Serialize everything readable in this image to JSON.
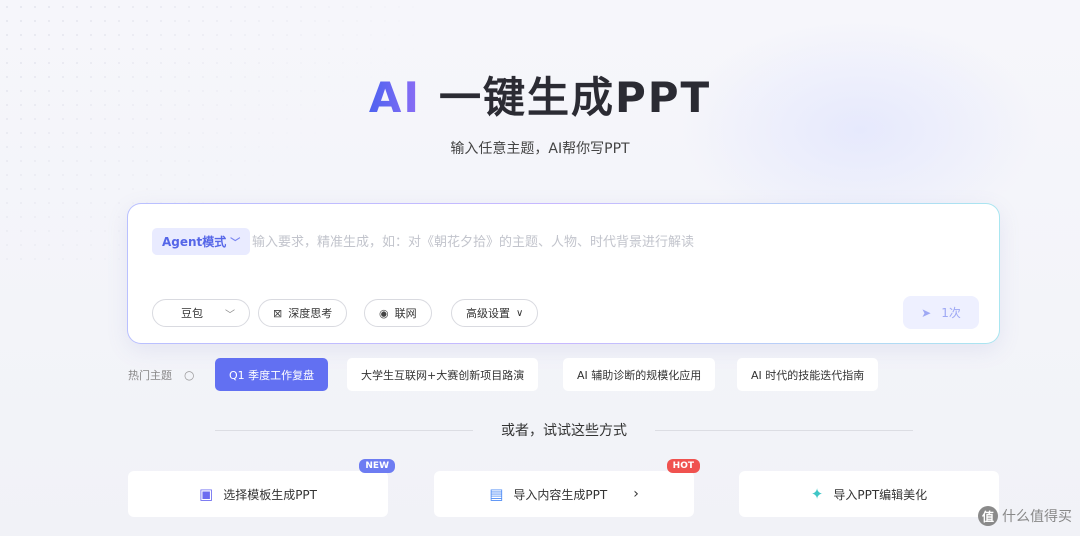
{
  "hero": {
    "title_ai": "AI",
    "title_rest": "一键生成PPT",
    "subtitle": "输入任意主题，AI帮你写PPT"
  },
  "input": {
    "mode_label": "Agent模式",
    "placeholder": "输入要求，精准生成，如：对《朝花夕拾》的主题、人物、时代背景进行解读",
    "value": "",
    "model_label": "豆包",
    "deep_think_label": "深度思考",
    "web_label": "联网",
    "advanced_label": "高级设置",
    "send_count": "1次"
  },
  "hot_topics": {
    "label": "热门主题",
    "items": [
      {
        "label": "Q1 季度工作复盘",
        "active": true
      },
      {
        "label": "大学生互联网+大赛创新项目路演",
        "active": false
      },
      {
        "label": "AI 辅助诊断的规模化应用",
        "active": false
      },
      {
        "label": "AI 时代的技能迭代指南",
        "active": false
      }
    ]
  },
  "or_text": "或者，试试这些方式",
  "options": [
    {
      "label": "选择模板生成PPT",
      "tag": "NEW",
      "icon": "template-icon"
    },
    {
      "label": "导入内容生成PPT",
      "tag": "HOT",
      "icon": "document-icon"
    },
    {
      "label": "导入PPT编辑美化",
      "tag": "",
      "icon": "magic-icon"
    }
  ],
  "watermark": {
    "badge": "值",
    "text": "什么值得买"
  },
  "colors": {
    "accent": "#6270f2",
    "hot": "#f0524f",
    "new": "#6d7cf2"
  }
}
